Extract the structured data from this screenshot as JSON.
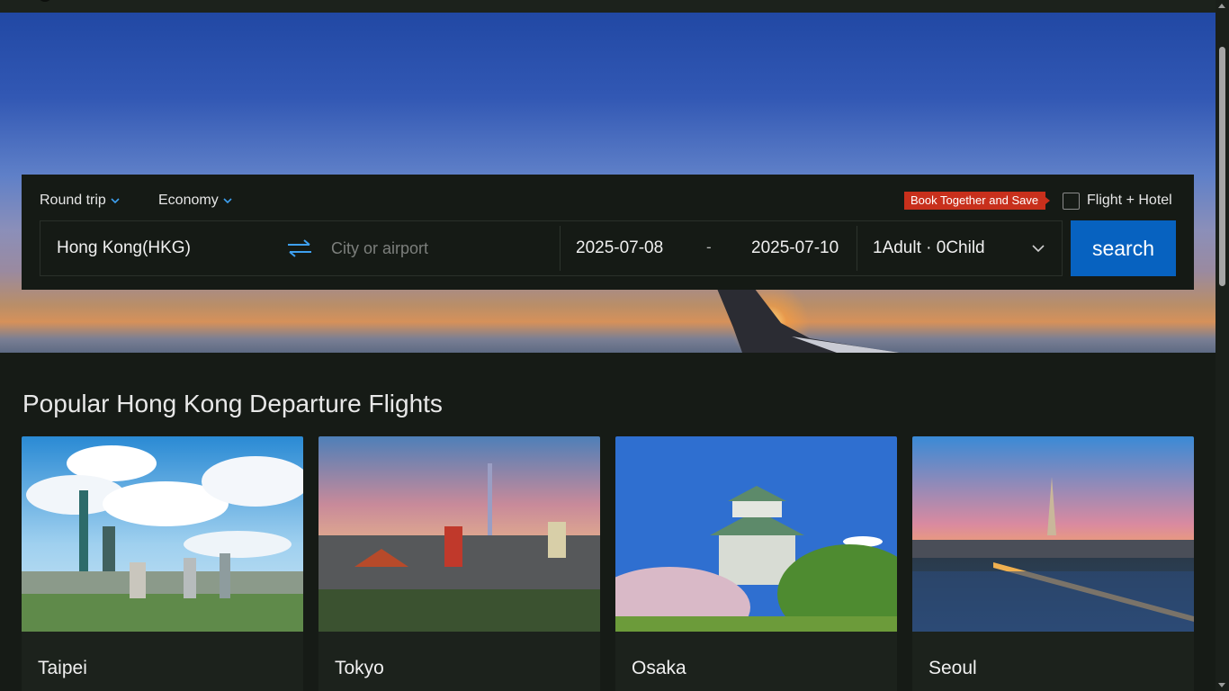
{
  "search": {
    "trip_type": "Round trip",
    "cabin_class": "Economy",
    "promo_badge": "Book Together and Save",
    "bundle_option_label": "Flight + Hotel",
    "bundle_checked": false,
    "from_value": "Hong Kong(HKG)",
    "to_placeholder": "City or airport",
    "depart_date": "2025-07-08",
    "date_separator": "-",
    "return_date": "2025-07-10",
    "passengers": "1Adult · 0Child",
    "search_button": "search"
  },
  "popular": {
    "title": "Popular Hong Kong Departure Flights",
    "cities": [
      {
        "name": "Taipei"
      },
      {
        "name": "Tokyo"
      },
      {
        "name": "Osaka"
      },
      {
        "name": "Seoul"
      }
    ]
  },
  "colors": {
    "accent_blue": "#0762c0",
    "promo_red": "#c8301c",
    "panel_bg": "#151a15",
    "page_bg": "#161b16"
  },
  "icons": [
    "chevron-down-icon",
    "swap-arrows-icon",
    "checkbox-icon"
  ]
}
